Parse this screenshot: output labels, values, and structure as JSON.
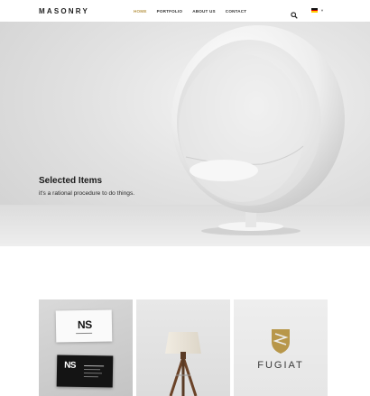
{
  "header": {
    "logo": "MASONRY",
    "nav": [
      {
        "label": "HOME",
        "active": true
      },
      {
        "label": "PORTFOLIO",
        "active": false
      },
      {
        "label": "ABOUT US",
        "active": false
      },
      {
        "label": "CONTACT",
        "active": false
      }
    ],
    "search_icon": "search-icon",
    "language_flag": "german-flag-icon",
    "accent_color": "#b8974a"
  },
  "hero": {
    "title": "Selected Items",
    "subtitle": "it's a rational procedure to do things."
  },
  "gallery": {
    "items": [
      {
        "image": "business-cards",
        "logo_text": "NS"
      },
      {
        "image": "tripod-lamp"
      },
      {
        "image": "fugiat-logo",
        "brand_text": "FUGIAT",
        "brand_color": "#b8974a"
      }
    ]
  }
}
